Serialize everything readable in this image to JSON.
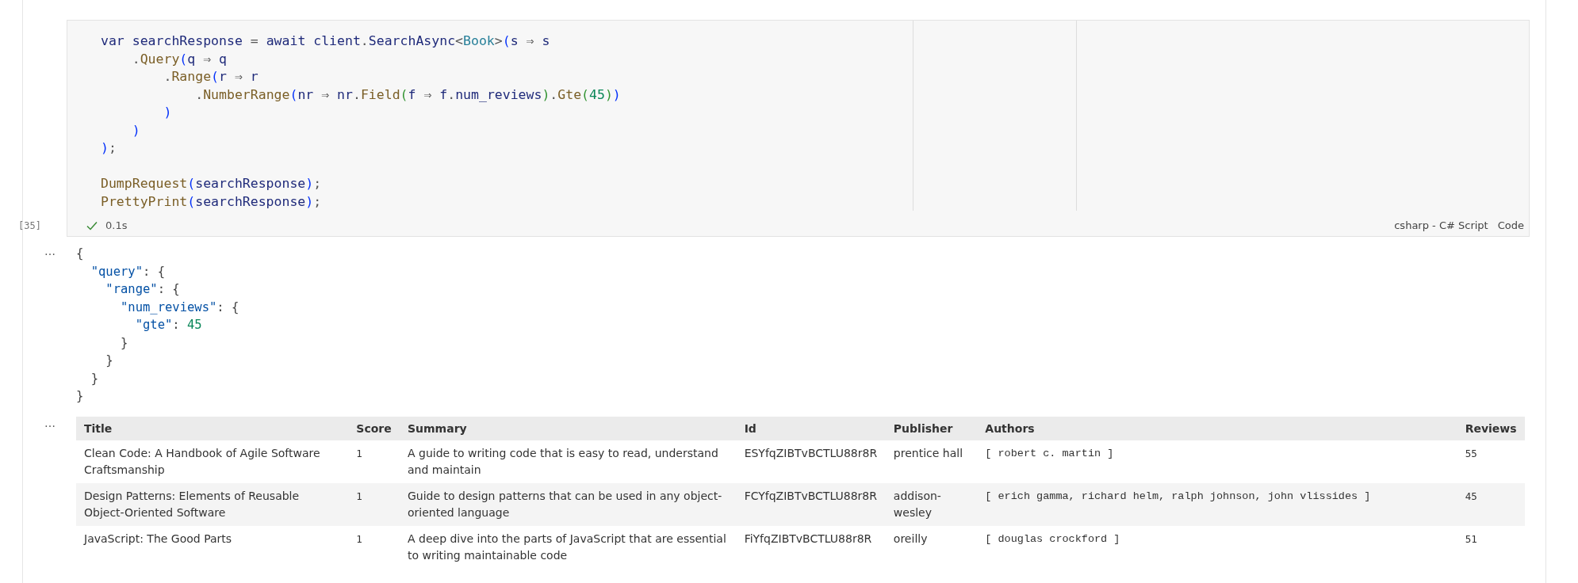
{
  "code_cell": {
    "code_blocks": [
      [
        "var searchResponse = await client.SearchAsync<Book>(s ⇒ s",
        "    .Query(q ⇒ q",
        "        .Range(r ⇒ r",
        "            .NumberRange(nr ⇒ nr.Field(f ⇒ f.num_reviews).Gte(45))",
        "        )",
        "    )",
        ");"
      ],
      [
        "DumpRequest(searchResponse);",
        "PrettyPrint(searchResponse);"
      ]
    ],
    "execution_count": "[35]",
    "succeeded": true,
    "duration": "0.1s",
    "language": "csharp - C# Script",
    "cell_type": "Code"
  },
  "outputs": [
    {
      "kind": "json",
      "more": "…",
      "lines": [
        "{",
        "  \"query\": {",
        "    \"range\": {",
        "      \"num_reviews\": {",
        "        \"gte\": 45",
        "      }",
        "    }",
        "  }",
        "}"
      ]
    },
    {
      "kind": "table",
      "more": "…",
      "columns": [
        "Title",
        "Score",
        "Summary",
        "Id",
        "Publisher",
        "Authors",
        "Reviews"
      ],
      "rows": [
        [
          "Clean Code: A Handbook of Agile Software Craftsmanship",
          "1",
          "A guide to writing code that is easy to read, understand and maintain",
          "ESYfqZIBTvBCTLU88r8R",
          "prentice hall",
          "[ robert c. martin ]",
          "55"
        ],
        [
          "Design Patterns: Elements of Reusable Object-Oriented Software",
          "1",
          "Guide to design patterns that can be used in any object-oriented language",
          "FCYfqZIBTvBCTLU88r8R",
          "addison-wesley",
          "[ erich gamma, richard helm, ralph johnson, john vlissides ]",
          "45"
        ],
        [
          "JavaScript: The Good Parts",
          "1",
          "A deep dive into the parts of JavaScript that are essential to writing maintainable code",
          "FiYfqZIBTvBCTLU88r8R",
          "oreilly",
          "[ douglas crockford ]",
          "51"
        ]
      ]
    }
  ]
}
